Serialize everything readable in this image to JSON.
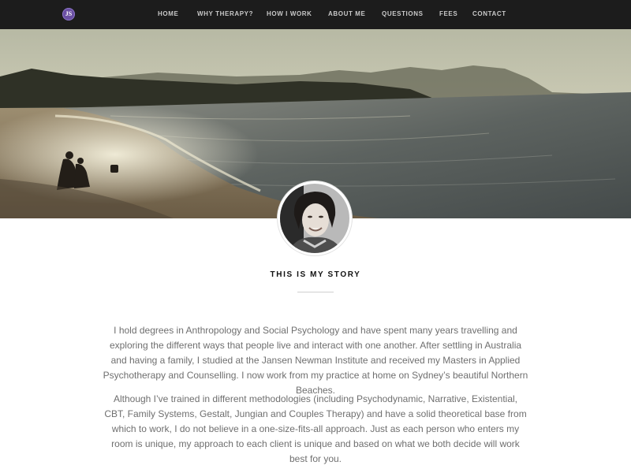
{
  "brand": {
    "logo_text": "JS",
    "logo_color": "#6a4fa3"
  },
  "nav": {
    "items": [
      {
        "label": "HOME"
      },
      {
        "label": "WHY THERAPY?"
      },
      {
        "label": "HOW I WORK"
      },
      {
        "label": "ABOUT ME"
      },
      {
        "label": "QUESTIONS"
      },
      {
        "label": "FEES"
      },
      {
        "label": "CONTACT"
      }
    ],
    "background": "#1c1c1c",
    "text_color": "#c9c9c9"
  },
  "hero": {
    "image_subject": "misty beach at sunset with people sitting on sand"
  },
  "profile": {
    "avatar": "portrait of smiling woman with short dark hair"
  },
  "story": {
    "title": "THIS IS MY STORY",
    "paragraphs": [
      "I hold degrees in Anthropology and Social Psychology and have spent many years travelling and exploring the different ways that people live and interact with one another. After settling in Australia and having a family, I studied at the Jansen Newman Institute and received my Masters in Applied Psychotherapy and Counselling. I now work from my practice at home on Sydney’s beautiful Northern Beaches.",
      "Although I’ve trained in different methodologies (including Psychodynamic, Narrative, Existential, CBT, Family Systems, Gestalt, Jungian and Couples Therapy) and have a solid theoretical base from which to work, I do not believe in a one-size-fits-all approach. Just as each person who enters my room is unique, my approach to each client is unique and based on what we both decide will work best for you."
    ]
  }
}
